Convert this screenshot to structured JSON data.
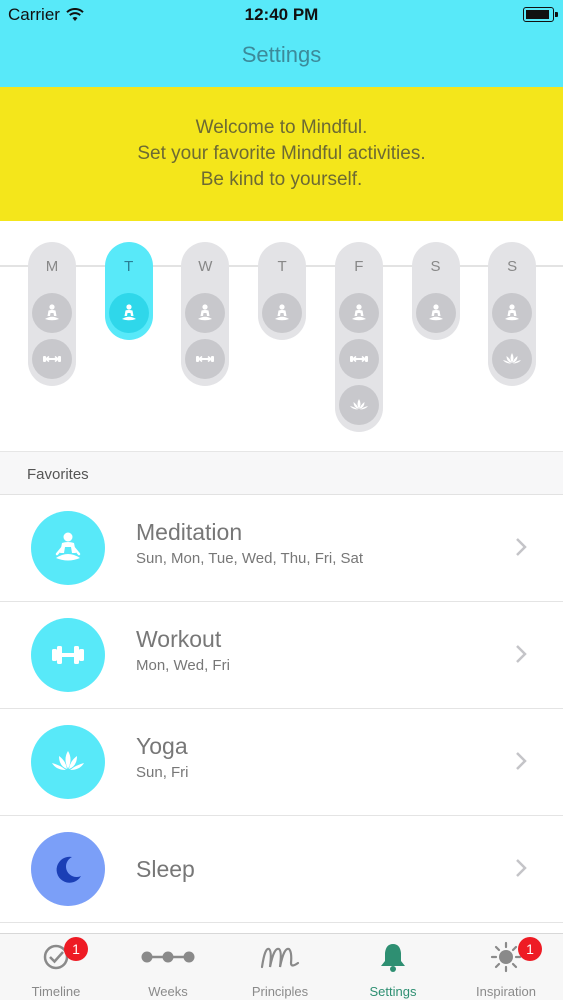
{
  "status_bar": {
    "carrier": "Carrier",
    "time": "12:40 PM",
    "battery_percent": 90
  },
  "nav": {
    "title": "Settings"
  },
  "welcome": {
    "lines": [
      "Welcome to Mindful.",
      "Set your favorite Mindful activities.",
      "Be kind to yourself."
    ],
    "background": "#f4e61b"
  },
  "week": {
    "days": [
      {
        "letter": "M",
        "active": false,
        "activities": [
          "meditation-icon",
          "workout-icon"
        ]
      },
      {
        "letter": "T",
        "active": true,
        "activities": [
          "meditation-icon"
        ]
      },
      {
        "letter": "W",
        "active": false,
        "activities": [
          "meditation-icon",
          "workout-icon"
        ]
      },
      {
        "letter": "T",
        "active": false,
        "activities": [
          "meditation-icon"
        ]
      },
      {
        "letter": "F",
        "active": false,
        "activities": [
          "meditation-icon",
          "workout-icon",
          "yoga-icon"
        ]
      },
      {
        "letter": "S",
        "active": false,
        "activities": [
          "meditation-icon"
        ]
      },
      {
        "letter": "S",
        "active": false,
        "activities": [
          "meditation-icon",
          "yoga-icon"
        ]
      }
    ]
  },
  "favorites": {
    "header": "Favorites",
    "items": [
      {
        "name": "Meditation",
        "days": "Sun, Mon, Tue, Wed, Thu, Fri, Sat",
        "icon": "meditation-icon",
        "color": "#58e9f9"
      },
      {
        "name": "Workout",
        "days": "Mon, Wed, Fri",
        "icon": "workout-icon",
        "color": "#58e9f9"
      },
      {
        "name": "Yoga",
        "days": "Sun, Fri",
        "icon": "yoga-icon",
        "color": "#58e9f9"
      },
      {
        "name": "Sleep",
        "days": "",
        "icon": "moon-icon",
        "color": "#7b9ff8"
      }
    ]
  },
  "tabbar": {
    "tabs": [
      {
        "label": "Timeline",
        "icon": "check-circle-icon",
        "badge": "1",
        "active": false
      },
      {
        "label": "Weeks",
        "icon": "dots-line-icon",
        "badge": "",
        "active": false
      },
      {
        "label": "Principles",
        "icon": "script-m-icon",
        "badge": "",
        "active": false
      },
      {
        "label": "Settings",
        "icon": "bell-icon",
        "badge": "",
        "active": true
      },
      {
        "label": "Inspiration",
        "icon": "sun-icon",
        "badge": "1",
        "active": false
      }
    ]
  },
  "colors": {
    "accent": "#58e9f9",
    "active_tab": "#2e8f72",
    "badge": "#ee1b24"
  }
}
